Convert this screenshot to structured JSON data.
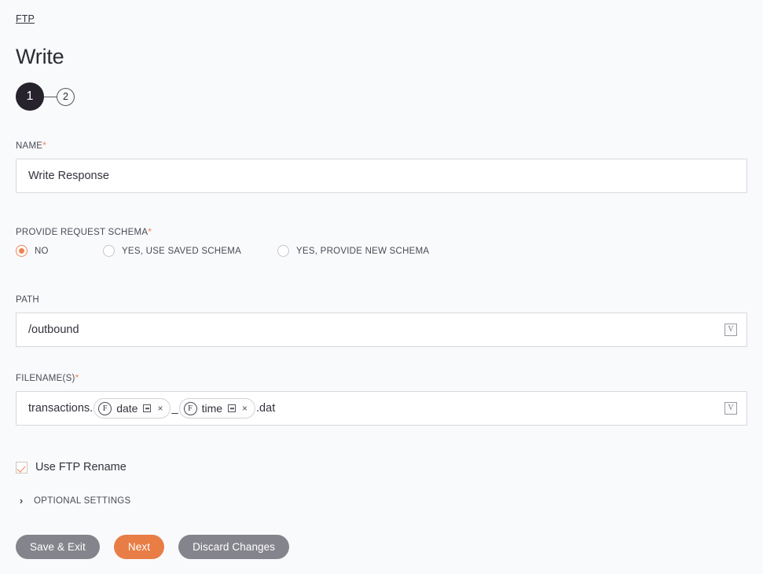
{
  "breadcrumb": {
    "label": "FTP"
  },
  "header": {
    "title": "Write"
  },
  "stepper": {
    "steps": [
      {
        "label": "1",
        "state": "active"
      },
      {
        "label": "2",
        "state": "inactive"
      }
    ]
  },
  "form": {
    "name": {
      "label": "NAME",
      "required_marker": "*",
      "value": "Write Response",
      "placeholder": "Name"
    },
    "provide_request_schema": {
      "label": "PROVIDE REQUEST SCHEMA",
      "required_marker": "*",
      "selected": "NO",
      "options": [
        {
          "label": "NO",
          "selected": true
        },
        {
          "label": "YES, USE SAVED SCHEMA",
          "selected": false
        },
        {
          "label": "YES, PROVIDE NEW SCHEMA",
          "selected": false
        }
      ]
    },
    "path": {
      "label": "PATH",
      "required_marker": "",
      "value": "/outbound",
      "dropdown_icon": "chevron-down-tofu",
      "dropdown_glyph": "V"
    },
    "filenames": {
      "label": "FILENAME(S)",
      "required_marker": "*",
      "dropdown_glyph": "V",
      "prefix_text": "transactions.",
      "separator_text": "_",
      "suffix_text": ".dat",
      "tokens": [
        {
          "badge": "F",
          "label": "date",
          "window_icon": "window-icon",
          "remove_icon": "×"
        },
        {
          "badge": "F",
          "label": "time",
          "window_icon": "window-icon",
          "remove_icon": "×"
        }
      ]
    },
    "use_ftp_rename": {
      "label": "Use FTP Rename",
      "checked": true
    },
    "optional_settings": {
      "label": "OPTIONAL SETTINGS",
      "chevron": "›",
      "expanded": false
    }
  },
  "actions": {
    "save_exit": "Save & Exit",
    "next": "Next",
    "discard": "Discard Changes"
  },
  "colors": {
    "accent": "#ef8354",
    "next_button": "#e87d45",
    "grey_button": "#84848c",
    "step_active": "#26232c",
    "page_background": "#f9fafc"
  }
}
